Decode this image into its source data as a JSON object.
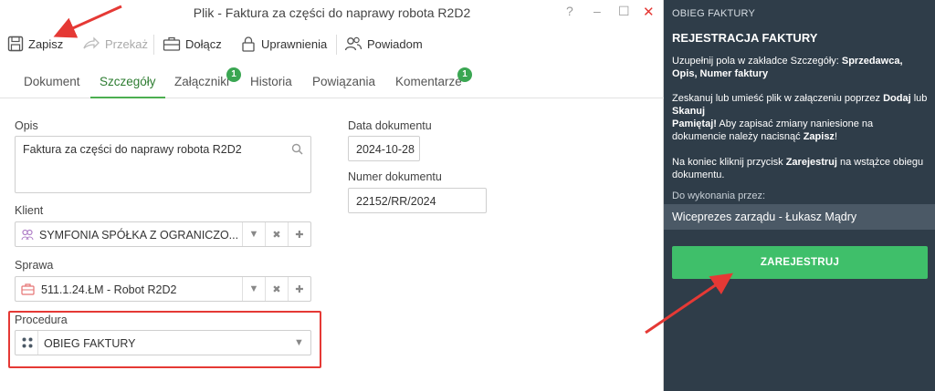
{
  "window": {
    "title": "Plik - Faktura za części do naprawy robota R2D2",
    "help": "?",
    "minimize": "–",
    "maximize": "☐",
    "close": "✕"
  },
  "toolbar": {
    "save": "Zapisz",
    "forward": "Przekaż",
    "attach": "Dołącz",
    "permissions": "Uprawnienia",
    "notify": "Powiadom"
  },
  "tabs": [
    {
      "label": "Dokument"
    },
    {
      "label": "Szczegóły",
      "active": true
    },
    {
      "label": "Załączniki",
      "badge": "1"
    },
    {
      "label": "Historia"
    },
    {
      "label": "Powiązania"
    },
    {
      "label": "Komentarze",
      "badge": "1"
    }
  ],
  "form": {
    "opis_label": "Opis",
    "opis_value": "Faktura za części do naprawy robota R2D2",
    "klient_label": "Klient",
    "klient_value": "SYMFONIA SPÓŁKA Z OGRANICZO...",
    "sprawa_label": "Sprawa",
    "sprawa_value": "511.1.24.ŁM - Robot R2D2",
    "procedura_label": "Procedura",
    "procedura_value": "OBIEG FAKTURY",
    "data_label": "Data dokumentu",
    "data_value": "2024-10-28",
    "numer_label": "Numer dokumentu",
    "numer_value": "22152/RR/2024"
  },
  "panel": {
    "header": "OBIEG FAKTURY",
    "title": "REJESTRACJA FAKTURY",
    "p1_a": "Uzupełnij pola w zakładce Szczegóły: ",
    "p1_b": "Sprzedawca, Opis, Numer faktury",
    "p2_a": "Zeskanuj lub umieść plik w załączeniu poprzez ",
    "p2_b": "Dodaj",
    "p2_c": " lub ",
    "p2_d": "Skanuj",
    "p3_a": "Pamiętaj!",
    "p3_b": " Aby zapisać zmiany naniesione na dokumencie należy nacisnąć ",
    "p3_c": "Zapisz",
    "p3_d": "!",
    "p4_a": "Na koniec kliknij przycisk ",
    "p4_b": "Zarejestruj",
    "p4_c": " na wstążce obiegu dokumentu.",
    "assignee_label": "Do wykonania przez:",
    "assignee": "Wiceprezes zarządu - Łukasz Mądry",
    "register_button": "ZAREJESTRUJ"
  },
  "colors": {
    "accent_green": "#3fbf6a",
    "panel_bg": "#2f3d49",
    "highlight_red": "#e53935"
  }
}
